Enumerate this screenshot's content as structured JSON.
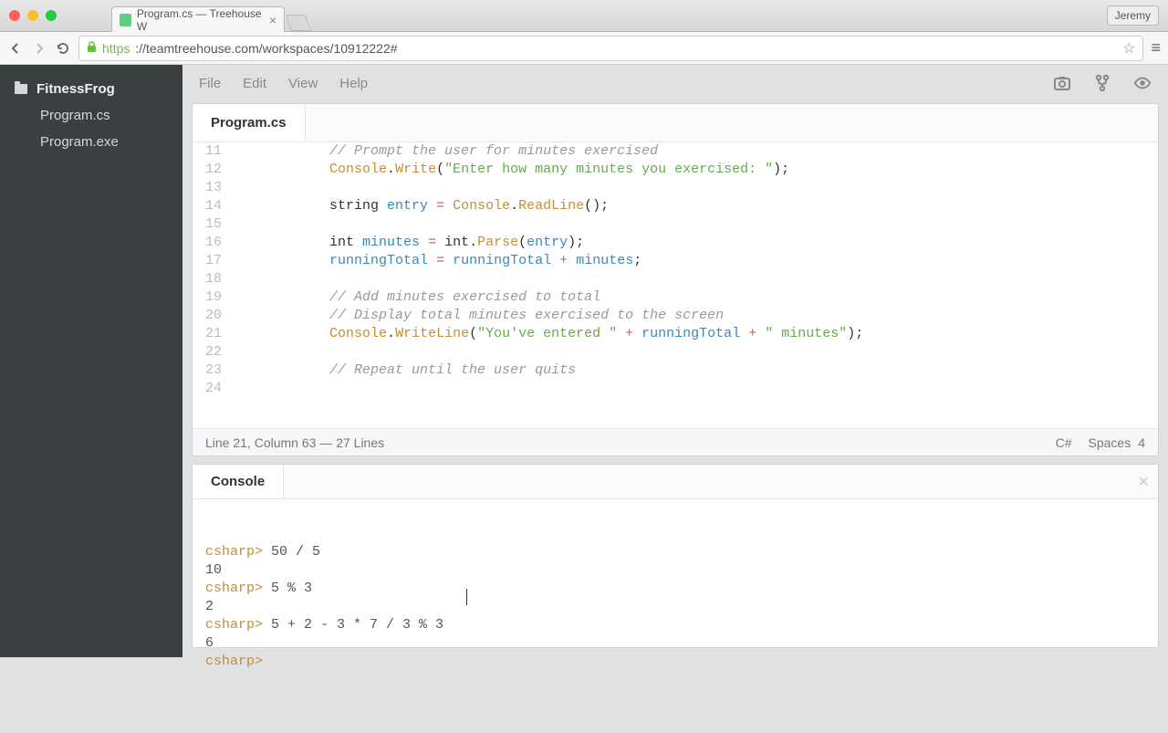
{
  "chrome": {
    "tab_title": "Program.cs — Treehouse W",
    "profile": "Jeremy",
    "url_https": "https",
    "url_rest": "://teamtreehouse.com/workspaces/10912222#"
  },
  "sidebar": {
    "folder": "FitnessFrog",
    "files": [
      "Program.cs",
      "Program.exe"
    ]
  },
  "menubar": {
    "items": [
      "File",
      "Edit",
      "View",
      "Help"
    ]
  },
  "editor": {
    "tab": "Program.cs",
    "lines": [
      {
        "n": 11,
        "segments": [
          {
            "t": "            ",
            "c": ""
          },
          {
            "t": "// Prompt the user for minutes exercised",
            "c": "c-comment"
          }
        ]
      },
      {
        "n": 12,
        "segments": [
          {
            "t": "            ",
            "c": ""
          },
          {
            "t": "Console",
            "c": "c-type"
          },
          {
            "t": ".",
            "c": "c-punct"
          },
          {
            "t": "Write",
            "c": "c-method"
          },
          {
            "t": "(",
            "c": "c-punct"
          },
          {
            "t": "\"Enter how many minutes you exercised: \"",
            "c": "c-string"
          },
          {
            "t": ");",
            "c": "c-punct"
          }
        ]
      },
      {
        "n": 13,
        "segments": []
      },
      {
        "n": 14,
        "segments": [
          {
            "t": "            string ",
            "c": ""
          },
          {
            "t": "entry",
            "c": "c-var"
          },
          {
            "t": " ",
            "c": ""
          },
          {
            "t": "=",
            "c": "c-op"
          },
          {
            "t": " ",
            "c": ""
          },
          {
            "t": "Console",
            "c": "c-type"
          },
          {
            "t": ".",
            "c": "c-punct"
          },
          {
            "t": "ReadLine",
            "c": "c-method"
          },
          {
            "t": "();",
            "c": "c-punct"
          }
        ]
      },
      {
        "n": 15,
        "segments": []
      },
      {
        "n": 16,
        "segments": [
          {
            "t": "            int ",
            "c": ""
          },
          {
            "t": "minutes",
            "c": "c-var"
          },
          {
            "t": " ",
            "c": ""
          },
          {
            "t": "=",
            "c": "c-op"
          },
          {
            "t": " int.",
            "c": ""
          },
          {
            "t": "Parse",
            "c": "c-method"
          },
          {
            "t": "(",
            "c": "c-punct"
          },
          {
            "t": "entry",
            "c": "c-var"
          },
          {
            "t": ");",
            "c": "c-punct"
          }
        ]
      },
      {
        "n": 17,
        "segments": [
          {
            "t": "            ",
            "c": ""
          },
          {
            "t": "runningTotal",
            "c": "c-var"
          },
          {
            "t": " ",
            "c": ""
          },
          {
            "t": "=",
            "c": "c-op"
          },
          {
            "t": " ",
            "c": ""
          },
          {
            "t": "runningTotal",
            "c": "c-var"
          },
          {
            "t": " ",
            "c": ""
          },
          {
            "t": "+",
            "c": "c-op"
          },
          {
            "t": " ",
            "c": ""
          },
          {
            "t": "minutes",
            "c": "c-var"
          },
          {
            "t": ";",
            "c": "c-punct"
          }
        ]
      },
      {
        "n": 18,
        "segments": []
      },
      {
        "n": 19,
        "segments": [
          {
            "t": "            ",
            "c": ""
          },
          {
            "t": "// Add minutes exercised to total",
            "c": "c-comment"
          }
        ]
      },
      {
        "n": 20,
        "segments": [
          {
            "t": "            ",
            "c": ""
          },
          {
            "t": "// Display total minutes exercised to the screen",
            "c": "c-comment"
          }
        ]
      },
      {
        "n": 21,
        "segments": [
          {
            "t": "            ",
            "c": ""
          },
          {
            "t": "Console",
            "c": "c-type"
          },
          {
            "t": ".",
            "c": "c-punct"
          },
          {
            "t": "WriteLine",
            "c": "c-method"
          },
          {
            "t": "(",
            "c": "c-punct"
          },
          {
            "t": "\"You've entered \"",
            "c": "c-string"
          },
          {
            "t": " ",
            "c": ""
          },
          {
            "t": "+",
            "c": "c-op"
          },
          {
            "t": " ",
            "c": ""
          },
          {
            "t": "runningTotal",
            "c": "c-var"
          },
          {
            "t": " ",
            "c": ""
          },
          {
            "t": "+",
            "c": "c-op"
          },
          {
            "t": " ",
            "c": ""
          },
          {
            "t": "\" minutes\"",
            "c": "c-string"
          },
          {
            "t": ");",
            "c": "c-punct"
          }
        ]
      },
      {
        "n": 22,
        "segments": []
      },
      {
        "n": 23,
        "segments": [
          {
            "t": "            ",
            "c": ""
          },
          {
            "t": "// Repeat until the user quits",
            "c": "c-comment"
          }
        ]
      },
      {
        "n": 24,
        "segments": []
      }
    ],
    "status": {
      "pos": "Line 21, Column 63 — 27 Lines",
      "lang": "C#",
      "indent_label": "Spaces",
      "indent_size": "4"
    }
  },
  "console": {
    "tab": "Console",
    "lines": [
      {
        "segments": [
          {
            "t": "csharp>",
            "c": "prompt"
          },
          {
            "t": " 50 / 5",
            "c": ""
          }
        ]
      },
      {
        "segments": [
          {
            "t": "10",
            "c": ""
          }
        ]
      },
      {
        "segments": [
          {
            "t": "csharp>",
            "c": "prompt"
          },
          {
            "t": " 5 % 3",
            "c": ""
          }
        ]
      },
      {
        "segments": [
          {
            "t": "2",
            "c": ""
          }
        ]
      },
      {
        "segments": [
          {
            "t": "csharp>",
            "c": "prompt"
          },
          {
            "t": " 5 + 2 - 3 * 7 / 3 % 3",
            "c": ""
          }
        ]
      },
      {
        "segments": [
          {
            "t": "6",
            "c": ""
          }
        ]
      },
      {
        "segments": [
          {
            "t": "csharp>",
            "c": "prompt"
          },
          {
            "t": " ",
            "c": ""
          }
        ]
      }
    ]
  }
}
